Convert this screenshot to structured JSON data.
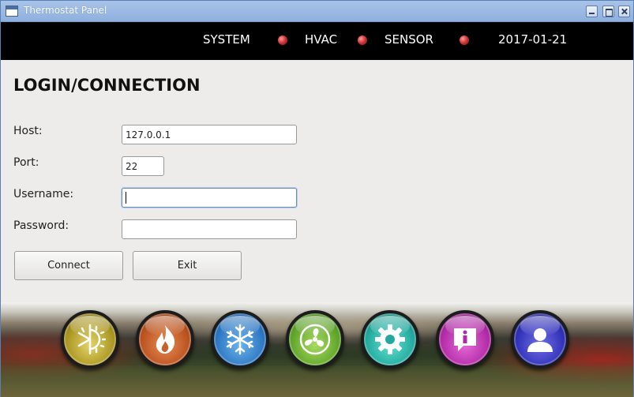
{
  "window": {
    "title": "Thermostat Panel"
  },
  "status_bar": {
    "items": [
      {
        "label": "SYSTEM",
        "indicator_color": "#c8282a"
      },
      {
        "label": "HVAC",
        "indicator_color": "#c8282a"
      },
      {
        "label": "SENSOR",
        "indicator_color": "#c8282a"
      }
    ],
    "date": "2017-01-21"
  },
  "login": {
    "heading": "LOGIN/CONNECTION",
    "host_label": "Host:",
    "host_value": "127.0.0.1",
    "port_label": "Port:",
    "port_value": "22",
    "username_label": "Username:",
    "username_value": "",
    "password_label": "Password:",
    "password_value": "",
    "connect_label": "Connect",
    "exit_label": "Exit"
  },
  "mode_buttons": [
    {
      "icon": "sun-snowflake-auto-icon",
      "color": "#c9b43a"
    },
    {
      "icon": "flame-icon",
      "color": "#c8602a"
    },
    {
      "icon": "snowflake-icon",
      "color": "#3a86d2"
    },
    {
      "icon": "fan-icon",
      "color": "#7ac23a"
    },
    {
      "icon": "gear-icon",
      "color": "#2fb8aa"
    },
    {
      "icon": "info-icon",
      "color": "#c030b4"
    },
    {
      "icon": "user-icon",
      "color": "#3a3ac8"
    }
  ]
}
